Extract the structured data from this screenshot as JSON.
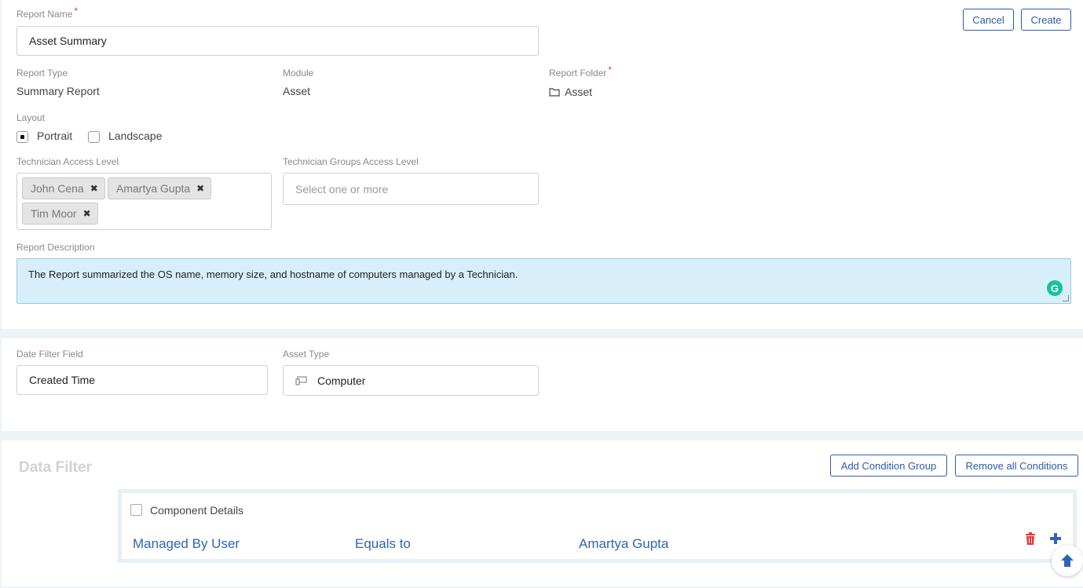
{
  "form": {
    "report_name_label": "Report Name",
    "report_name_value": "Asset Summary",
    "required_mark": "*",
    "report_type_label": "Report Type",
    "report_type_value": "Summary Report",
    "module_label": "Module",
    "module_value": "Asset",
    "report_folder_label": "Report Folder",
    "report_folder_value": "Asset",
    "layout_label": "Layout",
    "layout_options": [
      {
        "label": "Portrait",
        "selected": true
      },
      {
        "label": "Landscape",
        "selected": false
      }
    ],
    "tech_access_label": "Technician Access Level",
    "tech_access_tags": [
      "John Cena",
      "Amartya Gupta",
      "Tim Moor"
    ],
    "tag_remove_glyph": "✖",
    "tech_groups_label": "Technician Groups Access Level",
    "tech_groups_placeholder": "Select one or more",
    "description_label": "Report Description",
    "description_value": "The Report summarized the OS name, memory size, and hostname of computers managed by a Technician.",
    "grammarly_glyph": "G"
  },
  "actions": {
    "cancel_label": "Cancel",
    "create_label": "Create"
  },
  "filters": {
    "date_filter_label": "Date Filter Field",
    "date_filter_value": "Created Time",
    "asset_type_label": "Asset Type",
    "asset_type_value": "Computer"
  },
  "data_filter": {
    "title": "Data Filter",
    "add_group_label": "Add Condition Group",
    "remove_all_label": "Remove all Conditions",
    "group": {
      "component_details_label": "Component Details",
      "condition": {
        "field": "Managed By User",
        "operator": "Equals to",
        "value": "Amartya Gupta"
      }
    }
  },
  "icons": {
    "folder": "folder-icon",
    "computer": "computer-icon",
    "delete": "trash-icon",
    "add": "plus-icon",
    "scroll_top": "arrow-up-icon"
  },
  "colors": {
    "accent": "#2b5cab",
    "link": "#2f64b5",
    "danger": "#e53935",
    "description_bg": "#d8effb",
    "grammarly": "#15c39a"
  }
}
